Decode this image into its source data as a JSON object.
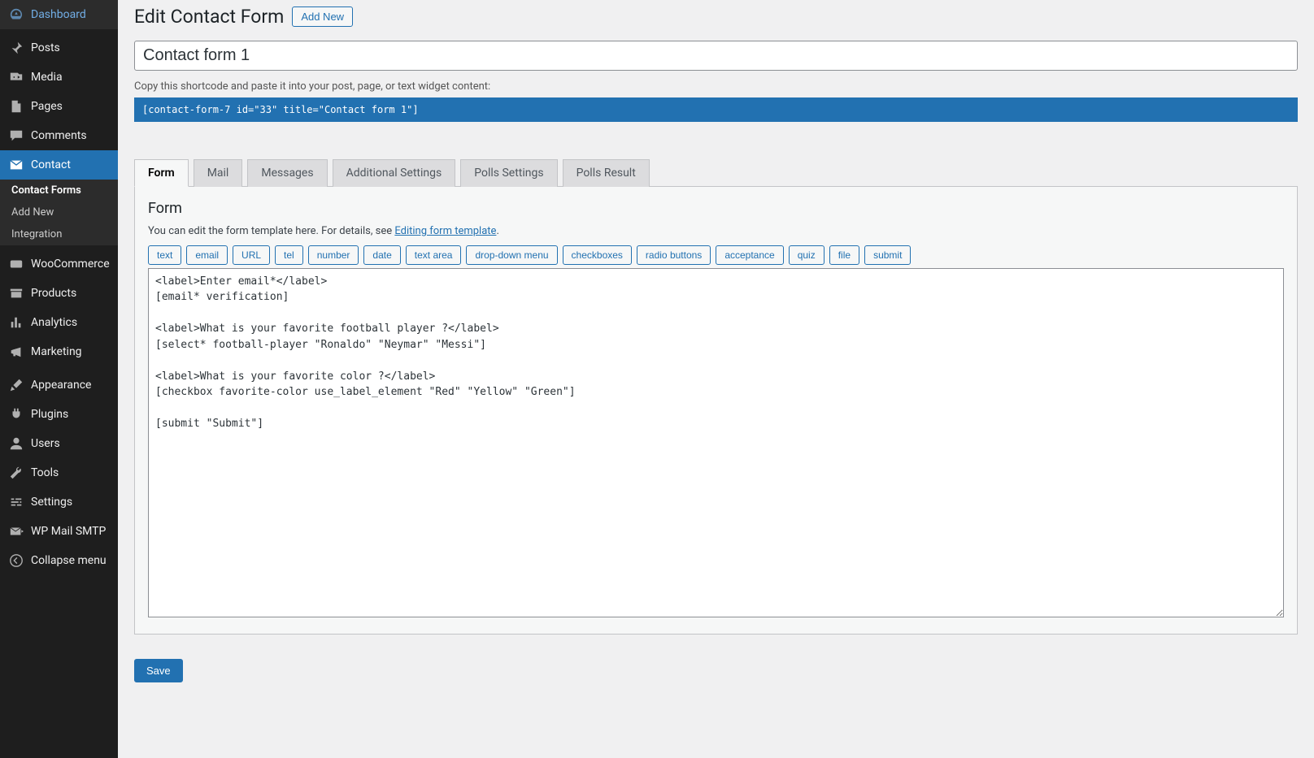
{
  "sidebar": {
    "dashboard": "Dashboard",
    "posts": "Posts",
    "media": "Media",
    "pages": "Pages",
    "comments": "Comments",
    "contact": "Contact",
    "contact_forms": "Contact Forms",
    "add_new": "Add New",
    "integration": "Integration",
    "woocommerce": "WooCommerce",
    "products": "Products",
    "analytics": "Analytics",
    "marketing": "Marketing",
    "appearance": "Appearance",
    "plugins": "Plugins",
    "users": "Users",
    "tools": "Tools",
    "settings": "Settings",
    "wp_mail_smtp": "WP Mail SMTP",
    "collapse": "Collapse menu"
  },
  "header": {
    "title": "Edit Contact Form",
    "add_new": "Add New"
  },
  "title_input_value": "Contact form 1",
  "shortcode_hint": "Copy this shortcode and paste it into your post, page, or text widget content:",
  "shortcode": "[contact-form-7 id=\"33\" title=\"Contact form 1\"]",
  "tabs": {
    "form": "Form",
    "mail": "Mail",
    "messages": "Messages",
    "additional": "Additional Settings",
    "polls_settings": "Polls Settings",
    "polls_result": "Polls Result"
  },
  "panel": {
    "title": "Form",
    "hint_before": "You can edit the form template here. For details, see ",
    "hint_link": "Editing form template",
    "hint_after": "."
  },
  "tag_buttons": [
    "text",
    "email",
    "URL",
    "tel",
    "number",
    "date",
    "text area",
    "drop-down menu",
    "checkboxes",
    "radio buttons",
    "acceptance",
    "quiz",
    "file",
    "submit"
  ],
  "form_code": "<label>Enter email*</label>\n[email* verification]\n\n<label>What is your favorite football player ?</label>\n[select* football-player \"Ronaldo\" \"Neymar\" \"Messi\"]\n\n<label>What is your favorite color ?</label>\n[checkbox favorite-color use_label_element \"Red\" \"Yellow\" \"Green\"]\n\n[submit \"Submit\"]",
  "save": "Save"
}
